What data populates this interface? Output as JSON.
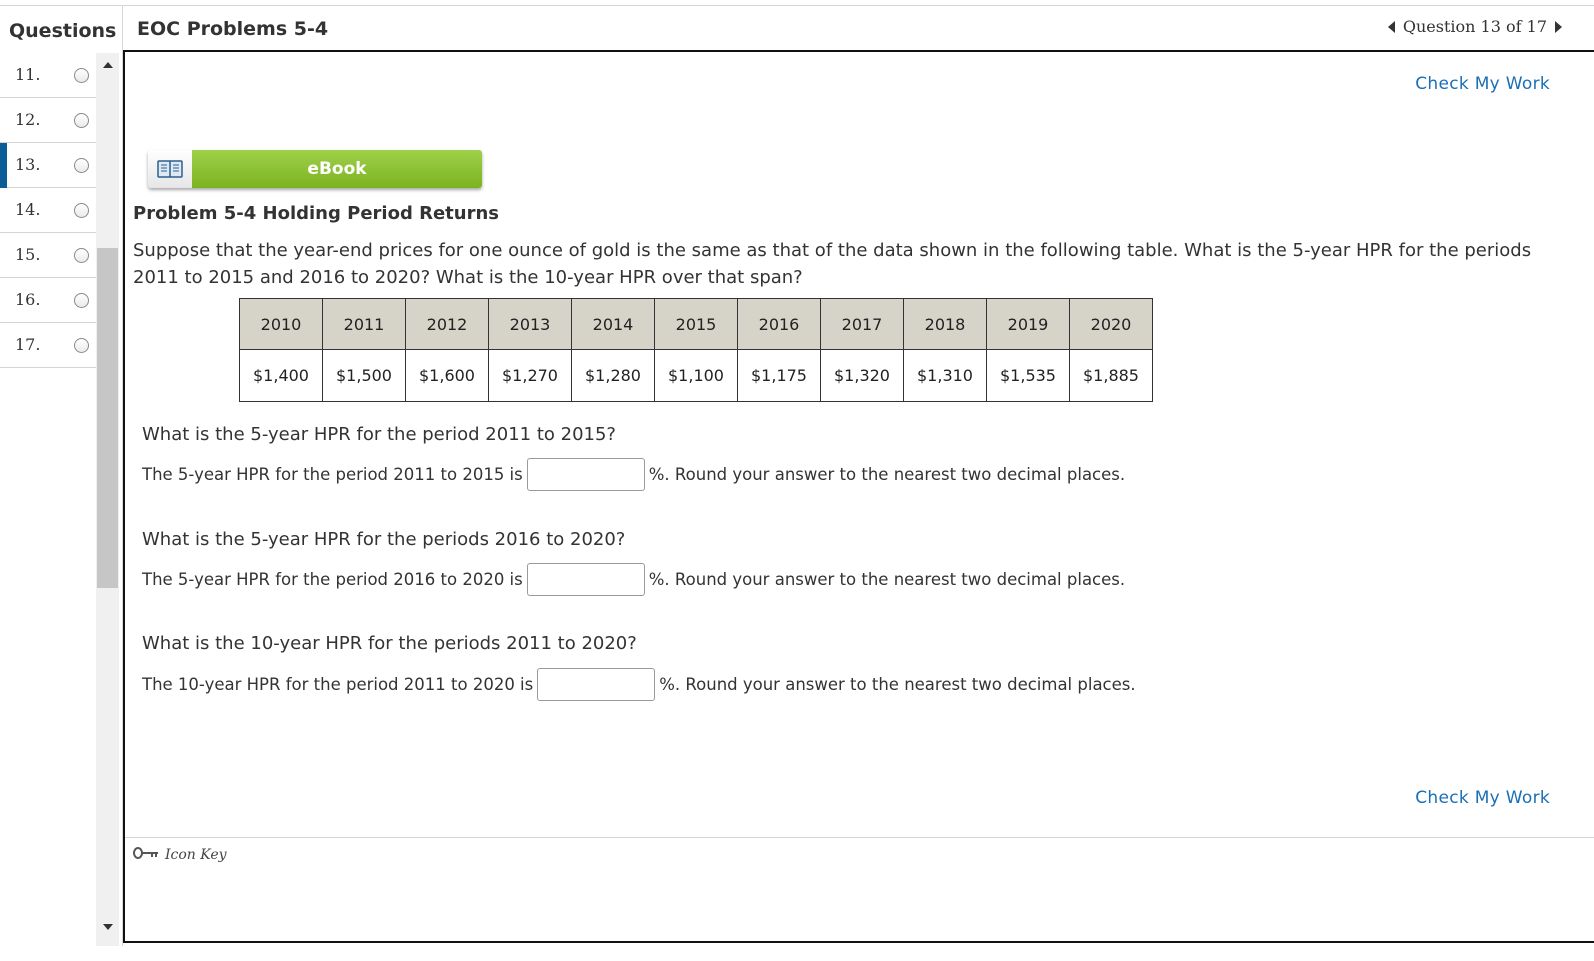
{
  "sidebar": {
    "title": "Questions",
    "items": [
      {
        "label": "11."
      },
      {
        "label": "12."
      },
      {
        "label": "13."
      },
      {
        "label": "14."
      },
      {
        "label": "15."
      },
      {
        "label": "16."
      },
      {
        "label": "17."
      }
    ],
    "active_item": "13."
  },
  "header": {
    "title": "EOC Problems 5-4",
    "nav_label": "Question 13 of 17"
  },
  "main": {
    "check_my_work": "Check My Work",
    "ebook_label": "eBook",
    "problem_title": "Problem 5-4 Holding Period Returns",
    "problem_text": "Suppose that the year-end prices for one ounce of gold is the same as that of the data shown in the following table. What is the 5-year HPR for the periods 2011 to 2015 and 2016 to 2020? What is the 10-year HPR over that span?",
    "table": {
      "years": [
        "2010",
        "2011",
        "2012",
        "2013",
        "2014",
        "2015",
        "2016",
        "2017",
        "2018",
        "2019",
        "2020"
      ],
      "prices": [
        "$1,400",
        "$1,500",
        "$1,600",
        "$1,270",
        "$1,280",
        "$1,100",
        "$1,175",
        "$1,320",
        "$1,310",
        "$1,535",
        "$1,885"
      ]
    },
    "questions": [
      {
        "heading": "What is the 5-year HPR for the period 2011 to 2015?",
        "prefix": "The 5-year HPR for the period 2011 to 2015 is",
        "suffix": "%. Round your answer to the nearest two decimal places.",
        "value": ""
      },
      {
        "heading": "What is the 5-year HPR for the periods 2016 to 2020?",
        "prefix": "The 5-year HPR for the period 2016 to 2020 is",
        "suffix": "%. Round your answer to the nearest two decimal places.",
        "value": ""
      },
      {
        "heading": "What is the 10-year HPR for the periods 2011 to 2020?",
        "prefix": "The 10-year HPR for the period 2011 to 2020 is",
        "suffix": "%. Round your answer to the nearest two decimal places.",
        "value": ""
      }
    ],
    "icon_key_label": "Icon Key"
  },
  "colors": {
    "accent_blue": "#1a6fb6",
    "active_marker": "#0a5d96",
    "ebook_green": "#8cc63f",
    "table_header_bg": "#d6d3c8"
  },
  "icons": [
    "book-icon",
    "key-icon",
    "chevron-left-icon",
    "chevron-right-icon",
    "scroll-up-icon",
    "scroll-down-icon"
  ]
}
